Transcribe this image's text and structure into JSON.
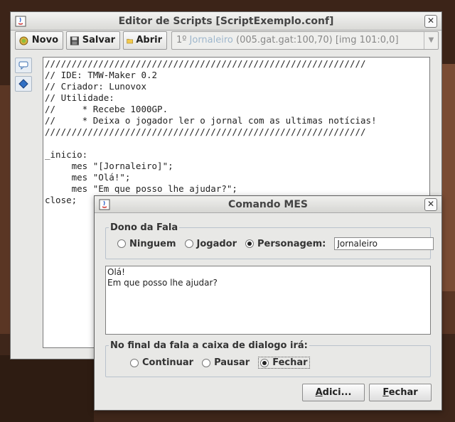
{
  "main_window": {
    "title": "Editor de Scripts [ScriptExemplo.conf]",
    "close_glyph": "✕"
  },
  "toolbar": {
    "new_label": "Novo",
    "save_label": "Salvar",
    "open_label": "Abrir",
    "npc_selector": {
      "prefix": "1º ",
      "name": "Jornaleiro",
      "suffix": " (005.gat.gat:100,70) [img 101:0,0]"
    }
  },
  "side_tools": {
    "items": [
      "speech-bubble-icon",
      "diamond-icon"
    ]
  },
  "editor": {
    "lines": [
      "////////////////////////////////////////////////////////////",
      "// IDE: TMW-Maker 0.2",
      "// Criador: Lunovox",
      "// Utilidade:",
      "//     * Recebe 1000GP.",
      "//     * Deixa o jogador ler o jornal com as ultimas notícias!",
      "////////////////////////////////////////////////////////////",
      "",
      "_inicio:",
      "     mes \"[Jornaleiro]\";",
      "     mes \"Olá!\";",
      "     mes \"Em que posso lhe ajudar?\";",
      "close;"
    ]
  },
  "dialog": {
    "title": "Comando MES",
    "close_glyph": "✕",
    "owner_group": {
      "legend": "Dono da Fala",
      "options": [
        "Ninguem",
        "Jogador",
        "Personagem:"
      ],
      "selected": "Personagem:",
      "character_name": "Jornaleiro"
    },
    "speech_text": [
      "Olá!",
      "Em que posso lhe ajudar?"
    ],
    "end_group": {
      "legend": "No final da fala a caixa de dialogo irá:",
      "options": [
        "Continuar",
        "Pausar",
        "Fechar"
      ],
      "selected": "Fechar"
    },
    "add_button": {
      "mnemonic": "A",
      "rest": "dici..."
    },
    "close_button": {
      "mnemonic": "F",
      "rest": "echar"
    }
  },
  "colors": {
    "window_bg": "#e8e8e6",
    "selection_hint": "#9db6cc"
  }
}
